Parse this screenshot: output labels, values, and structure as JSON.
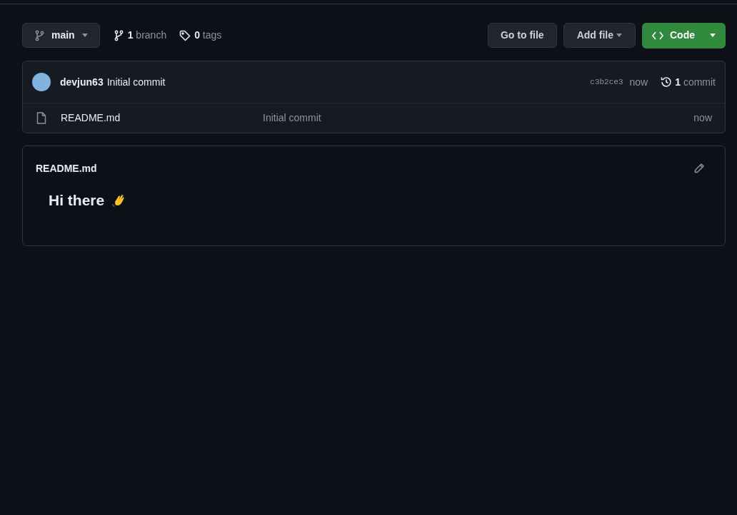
{
  "branch_select": {
    "label": "main"
  },
  "branches_link": "**1** branch",
  "tags_link": "**0** tags",
  "buttons": [
    {
      "kind": "plain",
      "label": "Go to file"
    },
    {
      "kind": "dropdown",
      "label": "Add file"
    },
    {
      "kind": "primary",
      "label": "Code"
    }
  ],
  "latest_commit": {
    "author": "devjun63",
    "message": "Initial commit",
    "sha": "c3b2ce3",
    "time": "now",
    "count": "1",
    "count_label": "commit"
  },
  "files": [
    {
      "name": "README.md",
      "message": "Initial commit",
      "time": "now"
    }
  ],
  "readme": {
    "title": "README.md",
    "heading": "Hi there"
  }
}
